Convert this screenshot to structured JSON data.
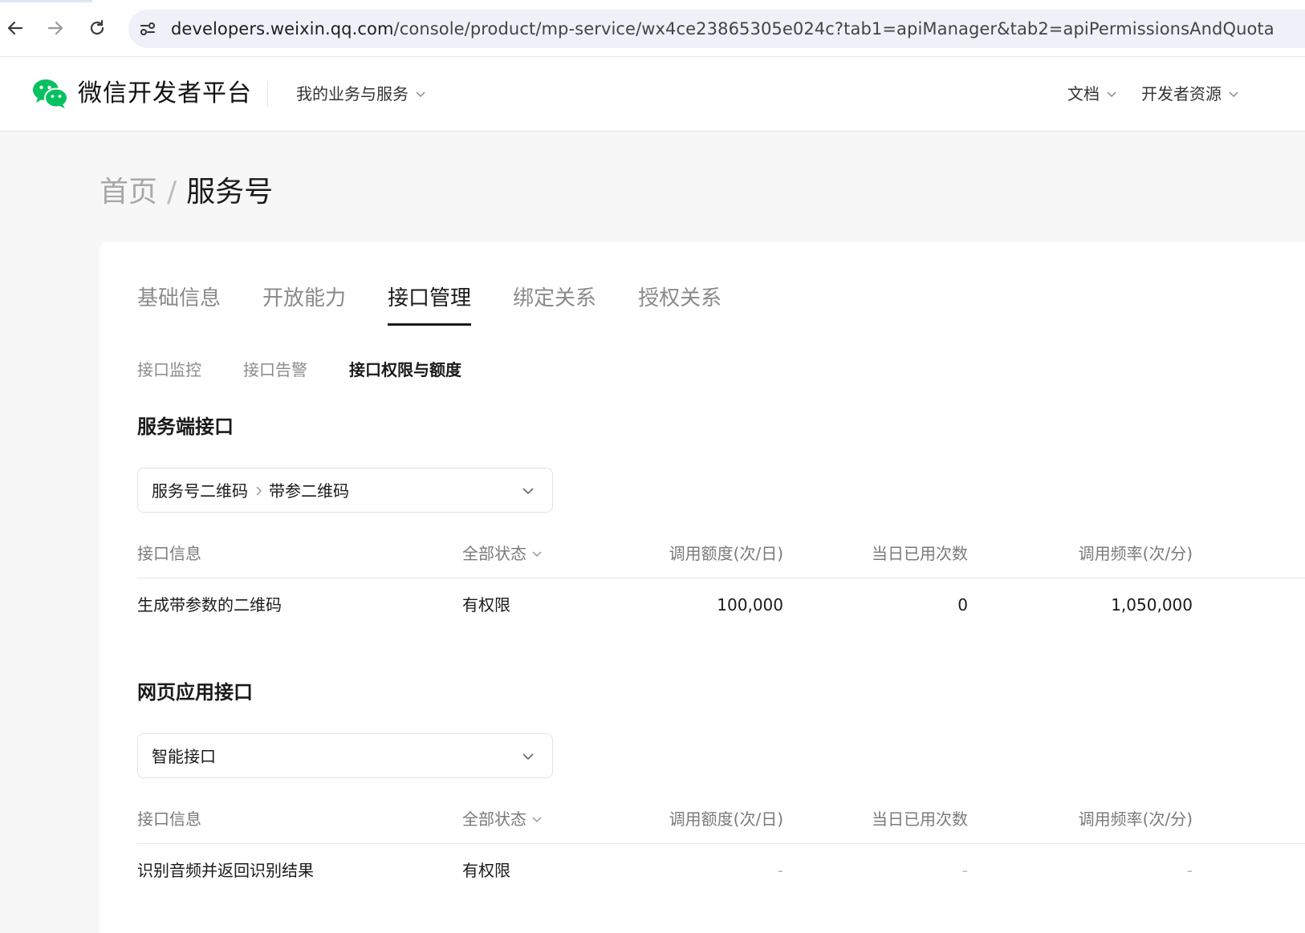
{
  "browser": {
    "url_host": "developers.weixin.qq.com",
    "url_path": "/console/product/mp-service/wx4ce23865305e024c?tab1=apiManager&tab2=apiPermissionsAndQuota"
  },
  "header": {
    "logo_text": "微信开发者平台",
    "menu_services": "我的业务与服务",
    "menu_docs": "文档",
    "menu_resources": "开发者资源"
  },
  "breadcrumb": {
    "home": "首页",
    "separator": "/",
    "current": "服务号"
  },
  "tabs": [
    {
      "label": "基础信息",
      "active": false
    },
    {
      "label": "开放能力",
      "active": false
    },
    {
      "label": "接口管理",
      "active": true
    },
    {
      "label": "绑定关系",
      "active": false
    },
    {
      "label": "授权关系",
      "active": false
    }
  ],
  "subtabs": [
    {
      "label": "接口监控",
      "active": false
    },
    {
      "label": "接口告警",
      "active": false
    },
    {
      "label": "接口权限与额度",
      "active": true
    }
  ],
  "table_headers": {
    "info": "接口信息",
    "status": "全部状态",
    "quota": "调用额度(次/日)",
    "used": "当日已用次数",
    "rate": "调用频率(次/分)"
  },
  "sections": [
    {
      "title": "服务端接口",
      "select": {
        "parent": "服务号二维码",
        "child": "带参二维码"
      },
      "rows": [
        {
          "name": "生成带参数的二维码",
          "status": "有权限",
          "quota": "100,000",
          "used": "0",
          "rate": "1,050,000"
        }
      ]
    },
    {
      "title": "网页应用接口",
      "select": {
        "parent": "智能接口",
        "child": ""
      },
      "rows": [
        {
          "name": "识别音频并返回识别结果",
          "status": "有权限",
          "quota": "-",
          "used": "-",
          "rate": "-"
        }
      ]
    }
  ],
  "colors": {
    "brand_green": "#07c160",
    "text_primary": "#1a1a1a",
    "text_muted": "#8a8a8a"
  }
}
